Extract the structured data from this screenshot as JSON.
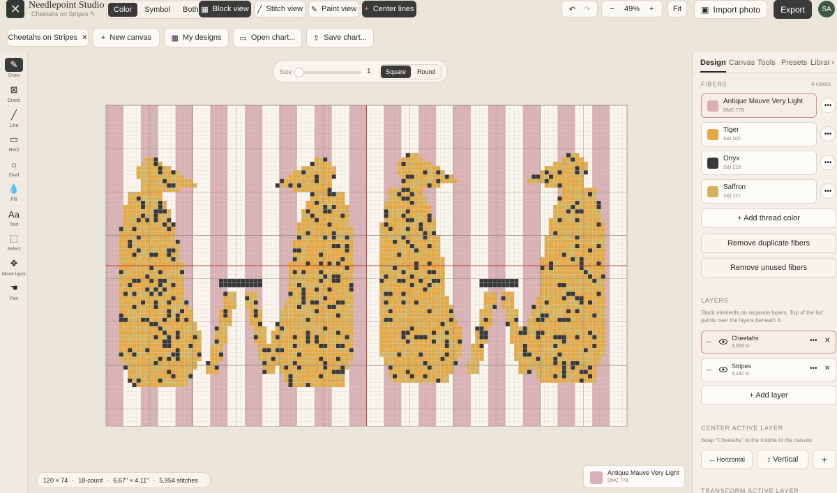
{
  "app": {
    "name": "Needlepoint Studio",
    "project": "Cheetahs on Stripes"
  },
  "topbar": {
    "mode_options": [
      "Color",
      "Symbol",
      "Both"
    ],
    "mode_selected": "Color",
    "block_view": "Block view",
    "stitch_view": "Stitch view",
    "paint_view": "Paint view",
    "center_lines": "Center lines",
    "zoom": "49%",
    "fit": "Fit",
    "import_photo": "Import photo",
    "export": "Export",
    "avatar": "SA"
  },
  "toolbar": {
    "tab": "Cheetahs on Stripes",
    "new_canvas": "New canvas",
    "my_designs": "My designs",
    "open_chart": "Open chart...",
    "save_chart": "Save chart..."
  },
  "tools": [
    {
      "label": "Draw",
      "icon": "pencil-icon",
      "glyph": "✎"
    },
    {
      "label": "Erase",
      "icon": "eraser-icon",
      "glyph": "⊠"
    },
    {
      "label": "Line",
      "icon": "line-icon",
      "glyph": "╱"
    },
    {
      "label": "Rect",
      "icon": "rect-icon",
      "glyph": "▭"
    },
    {
      "label": "Oval",
      "icon": "oval-icon",
      "glyph": "○"
    },
    {
      "label": "Fill",
      "icon": "fill-icon",
      "glyph": "💧"
    },
    {
      "label": "Text",
      "icon": "text-icon",
      "glyph": "Aa"
    },
    {
      "label": "Select",
      "icon": "select-icon",
      "glyph": "⬚"
    },
    {
      "label": "Move layer",
      "icon": "move-icon",
      "glyph": "✥"
    },
    {
      "label": "Pan",
      "icon": "hand-icon",
      "glyph": "☚"
    }
  ],
  "brush": {
    "size_label": "Size",
    "size_value": "1",
    "size_fraction": 0.0,
    "shape_options": [
      "Square",
      "Round"
    ],
    "shape_selected": "Square"
  },
  "status": {
    "grid": "120 × 74",
    "count": "18-count",
    "size": "6.67\" × 4.11\"",
    "stitches": "5,954 stitches"
  },
  "active_color": {
    "name": "Antique Mauve Very Light",
    "code": "DMC 778",
    "color": "#d8b0b6"
  },
  "panel": {
    "tabs": [
      "Design",
      "Canvas",
      "Tools",
      "Presets",
      "Librar"
    ],
    "active_tab": "Design",
    "fibers_title": "FIBERS",
    "fibers_count": "4 colors",
    "fibers": [
      {
        "name": "Antique Mauve Very Light",
        "code": "DMC 778",
        "color": "#d8b0b6"
      },
      {
        "name": "Tiger",
        "code": "S&I 202",
        "color": "#e5a948"
      },
      {
        "name": "Onyx",
        "code": "S&I 219",
        "color": "#38393a"
      },
      {
        "name": "Saffron",
        "code": "S&I 121",
        "color": "#d4b460"
      }
    ],
    "add_thread": "+ Add thread color",
    "remove_dup": "Remove duplicate fibers",
    "remove_unused": "Remove unused fibers",
    "layers_title": "LAYERS",
    "layers_desc": "Stack elements on separate layers. Top of the list paints over the layers beneath it.",
    "layers": [
      {
        "name": "Cheetahs",
        "count": "3,029 st"
      },
      {
        "name": "Stripes",
        "count": "4,440 st"
      }
    ],
    "add_layer": "+ Add layer",
    "center_title": "CENTER ACTIVE LAYER",
    "center_desc": "Snap \"Cheetahs\" to the middle of the canvas.",
    "horizontal": "↔ Horizontal",
    "vertical": "↕ Vertical",
    "plus": "+",
    "transform_title": "TRANSFORM ACTIVE LAYER"
  },
  "colors": {
    "stripe_pink": "#d8b0b6",
    "canvas_cream": "#faf6ef",
    "tiger": "#e5a948",
    "saffron": "#d4b460",
    "onyx": "#38393a",
    "accent_border": "#c99588"
  }
}
